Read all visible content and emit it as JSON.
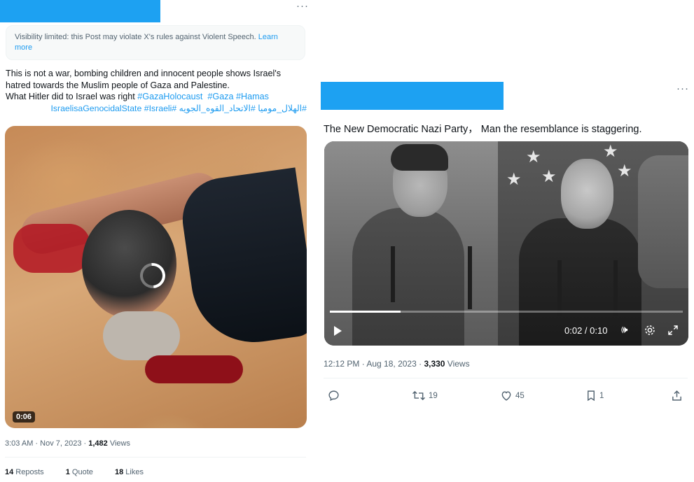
{
  "left_post": {
    "more_label": "···",
    "notice_text": "Visibility limited: this Post may violate X's rules against Violent Speech.",
    "notice_link": "Learn more",
    "body_line1": "This is not a war, bombing children and innocent people shows Israel's hatred towards the Muslim people of Gaza and Palestine.",
    "body_line3_prefix": "What Hitler did to Israel was right ",
    "hashtags": [
      "#GazaHolocaust",
      "#Gaza",
      "#Hamas"
    ],
    "arabic_line": "#الهلال_موميا #الاتحاد_القوه_الجويه #IsraelisaGenocidalState #Israeli",
    "video_duration": "0:06",
    "timestamp": "3:03 AM · Nov 7, 2023 · ",
    "views_count": "1,482",
    "views_label": " Views",
    "reposts_count": "14",
    "reposts_label": " Reposts",
    "quotes_count": "1",
    "quotes_label": " Quote",
    "likes_count": "18",
    "likes_label": " Likes"
  },
  "right_post": {
    "more_label": "···",
    "text": "The New Democratic Nazi Party，  Man the resemblance is staggering.",
    "video_time": "0:02 / 0:10",
    "video_progress": 0.2,
    "timestamp": "12:12 PM · Aug 18, 2023 · ",
    "views_count": "3,330",
    "views_label": " Views",
    "retweets_count": "19",
    "likes_count": "45",
    "bookmarks_count": "1"
  },
  "colors": {
    "accent": "#1d9bf0",
    "redaction": "#1da1f2",
    "muted": "#536471"
  },
  "icons": [
    "reply-icon",
    "retweet-icon",
    "like-icon",
    "bookmark-icon",
    "share-icon",
    "play-icon",
    "volume-icon",
    "settings-icon",
    "fullscreen-icon",
    "loading-spinner-icon"
  ]
}
